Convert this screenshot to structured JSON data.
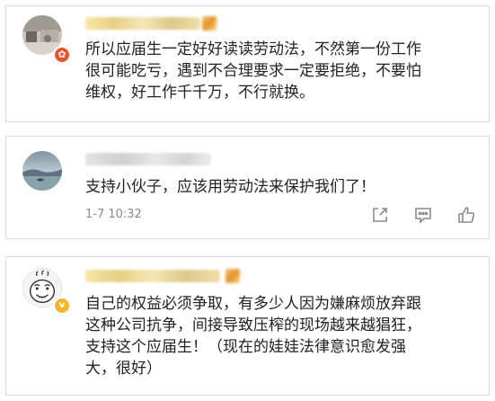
{
  "comments": [
    {
      "text": "所以应届生一定好好读读劳动法，不然第一份工作\n很可能吃亏，遇到不合理要求一定要拒绝，不要怕\n维权，好工作千千万，不行就换。",
      "badge_icon": "fire-badge-icon"
    },
    {
      "text": "支持小伙子，应该用劳动法来保护我们了！",
      "timestamp": "1-7 10:32",
      "actions": [
        "share-icon",
        "comment-icon",
        "like-icon"
      ]
    },
    {
      "text": "自己的权益必须争取，有多少人因为嫌麻烦放弃跟\n这种公司抗争，间接导致压榨的现场越来越猖狂，\n支持这个应届生！（现在的娃娃法律意识愈发强\n大，很好）",
      "badge_icon": "verified-v-badge-icon",
      "badge_text": "v"
    }
  ],
  "colors": {
    "border": "#d9d9d9",
    "text": "#222222",
    "meta": "#8a8a8a",
    "badge_red": "#e8542f",
    "badge_gold": "#f3b62d"
  }
}
